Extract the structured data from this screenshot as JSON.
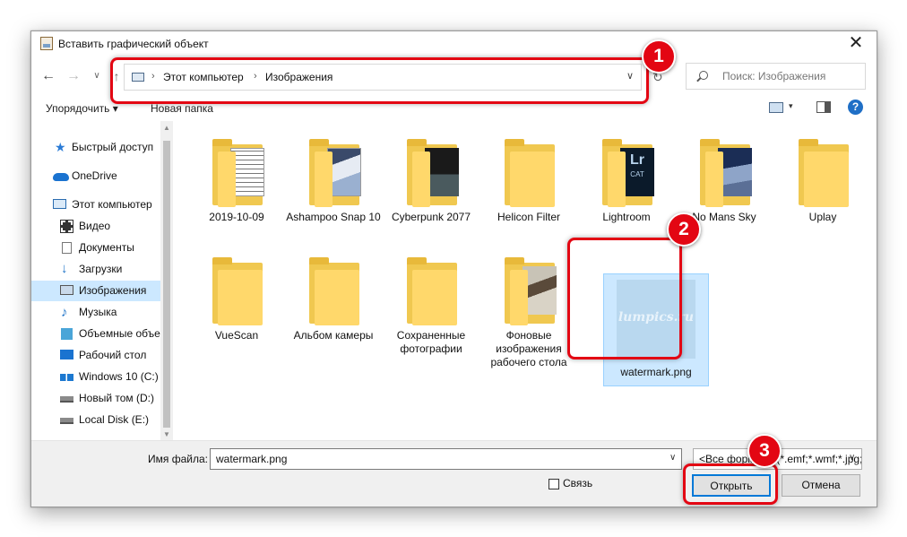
{
  "window": {
    "title": "Вставить графический объект",
    "close_glyph": "✕"
  },
  "nav": {
    "back": "←",
    "forward": "→",
    "recent": "∨",
    "up": "↑",
    "refresh": "↻"
  },
  "address": {
    "segments": [
      "Этот компьютер",
      "Изображения"
    ],
    "separator": "›",
    "dropdown": "∨"
  },
  "search": {
    "placeholder": "Поиск: Изображения"
  },
  "toolbar": {
    "organize": "Упорядочить ▾",
    "new_folder": "Новая папка",
    "view_dropdown": "▾",
    "help": "?"
  },
  "sidebar": {
    "items": [
      {
        "label": "Быстрый доступ",
        "icon": "star-icon"
      },
      {
        "label": "OneDrive",
        "icon": "cloud-icon"
      },
      {
        "label": "Этот компьютер",
        "icon": "computer-icon"
      },
      {
        "label": "Видео",
        "icon": "video-icon"
      },
      {
        "label": "Документы",
        "icon": "documents-icon"
      },
      {
        "label": "Загрузки",
        "icon": "downloads-icon"
      },
      {
        "label": "Изображения",
        "icon": "pictures-icon",
        "selected": true
      },
      {
        "label": "Музыка",
        "icon": "music-icon"
      },
      {
        "label": "Объемные объе",
        "icon": "3d-objects-icon"
      },
      {
        "label": "Рабочий стол",
        "icon": "desktop-icon"
      },
      {
        "label": "Windows 10 (C:)",
        "icon": "windows-drive-icon"
      },
      {
        "label": "Новый том (D:)",
        "icon": "drive-icon"
      },
      {
        "label": "Local Disk (E:)",
        "icon": "drive-icon"
      }
    ]
  },
  "files": [
    {
      "name": "2019-10-09",
      "type": "folder"
    },
    {
      "name": "Ashampoo Snap 10",
      "type": "folder"
    },
    {
      "name": "Cyberpunk 2077",
      "type": "folder"
    },
    {
      "name": "Helicon Filter",
      "type": "folder"
    },
    {
      "name": "Lightroom",
      "type": "folder",
      "thumb_text": "Lr",
      "thumb_sub": "CAT"
    },
    {
      "name": "No Mans Sky",
      "type": "folder"
    },
    {
      "name": "Uplay",
      "type": "folder"
    },
    {
      "name": "VueScan",
      "type": "folder"
    },
    {
      "name": "Альбом камеры",
      "type": "folder"
    },
    {
      "name": "Сохраненные фотографии",
      "type": "folder"
    },
    {
      "name": "Фоновые изображения рабочего стола",
      "type": "folder"
    },
    {
      "name": "watermark.png",
      "type": "image",
      "selected": true,
      "thumb_text": "lumpics.ru"
    }
  ],
  "bottom": {
    "filename_label": "Имя файла:",
    "filename_value": "watermark.png",
    "filter_value": "<Все форматы (*.emf;*.wmf;*.jpg;*.jpeg;*.jfif;*.jpe;*.png;*.bmp;*.dxf;*",
    "link_label": "Связь",
    "link_checked": false,
    "open_button": "Открыть",
    "cancel_button": "Отмена"
  },
  "callouts": [
    "1",
    "2",
    "3"
  ],
  "colors": {
    "callout": "#e30613",
    "selection": "#cce8ff",
    "folder": "#ffd86b"
  }
}
